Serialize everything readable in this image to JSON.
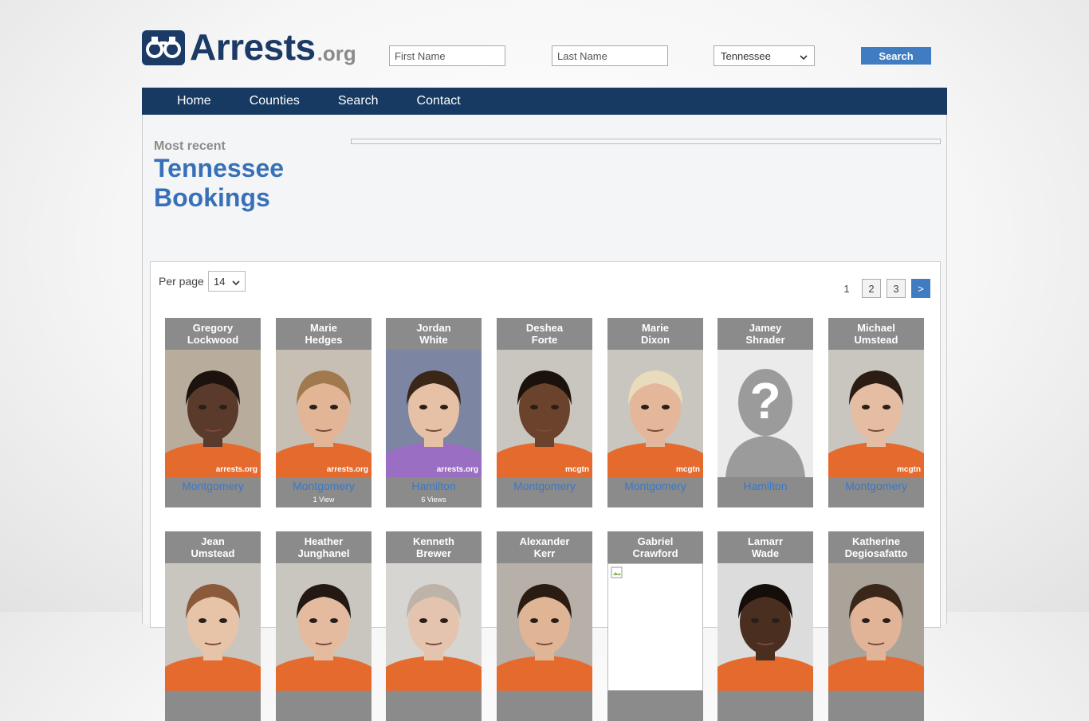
{
  "header": {
    "logo_word": "Arrests",
    "logo_suffix": ".org",
    "first_name_placeholder": "First Name",
    "last_name_placeholder": "Last Name",
    "state_selected": "Tennessee",
    "search_label": "Search"
  },
  "nav": [
    "Home",
    "Counties",
    "Search",
    "Contact"
  ],
  "section": {
    "eyebrow": "Most recent",
    "title_line1": "Tennessee",
    "title_line2": "Bookings"
  },
  "listing": {
    "per_page_label": "Per page",
    "per_page_value": "14",
    "pages": [
      "1",
      "2",
      "3"
    ],
    "next_label": ">"
  },
  "people": [
    {
      "first": "Gregory",
      "last": "Lockwood",
      "county": "Montgomery",
      "views": "",
      "skin": "#5a3a2a",
      "shirt": "#e56a2e",
      "bg": "#b8ad9c",
      "hair": "#1c130e",
      "watermark": "arrests.org"
    },
    {
      "first": "Marie",
      "last": "Hedges",
      "county": "Montgomery",
      "views": "1 View",
      "skin": "#e2b596",
      "shirt": "#e56a2e",
      "bg": "#c7bfb3",
      "hair": "#a07a4e",
      "watermark": "arrests.org"
    },
    {
      "first": "Jordan",
      "last": "White",
      "county": "Hamilton",
      "views": "6 Views",
      "skin": "#e7c1a6",
      "shirt": "#9a6ec2",
      "bg": "#7c86a2",
      "hair": "#3b2718",
      "watermark": "arrests.org"
    },
    {
      "first": "Deshea",
      "last": "Forte",
      "county": "Montgomery",
      "views": "",
      "skin": "#6b432c",
      "shirt": "#e56a2e",
      "bg": "#c9c6c0",
      "hair": "#1b120c",
      "watermark": "mcgtn"
    },
    {
      "first": "Marie",
      "last": "Dixon",
      "county": "Montgomery",
      "views": "",
      "skin": "#e4b79a",
      "shirt": "#e56a2e",
      "bg": "#c9c6c0",
      "hair": "#e9dcbc",
      "watermark": "mcgtn"
    },
    {
      "first": "Jamey",
      "last": "Shrader",
      "county": "Hamilton",
      "views": "",
      "skin": "",
      "shirt": "",
      "bg": "#ebebeb",
      "hair": "",
      "watermark": ""
    },
    {
      "first": "Michael",
      "last": "Umstead",
      "county": "Montgomery",
      "views": "",
      "skin": "#e5bda3",
      "shirt": "#e56a2e",
      "bg": "#c9c6c0",
      "hair": "#2c1d14",
      "watermark": "mcgtn"
    },
    {
      "first": "Jean",
      "last": "Umstead",
      "county": "",
      "views": "",
      "skin": "#e7c3a8",
      "shirt": "#e56a2e",
      "bg": "#c9c6c0",
      "hair": "#8a5a3a",
      "watermark": ""
    },
    {
      "first": "Heather",
      "last": "Junghanel",
      "county": "",
      "views": "",
      "skin": "#e4bb9f",
      "shirt": "#e56a2e",
      "bg": "#c9c6c0",
      "hair": "#231812",
      "watermark": ""
    },
    {
      "first": "Kenneth",
      "last": "Brewer",
      "county": "",
      "views": "",
      "skin": "#e4c4ae",
      "shirt": "#e56a2e",
      "bg": "#d7d5d2",
      "hair": "#bdb3a9",
      "watermark": ""
    },
    {
      "first": "Alexander",
      "last": "Kerr",
      "county": "",
      "views": "",
      "skin": "#e0b595",
      "shirt": "#e56a2e",
      "bg": "#b6b0a8",
      "hair": "#2a1c12",
      "watermark": ""
    },
    {
      "first": "Gabriel",
      "last": "Crawford",
      "county": "",
      "views": "",
      "skin": "",
      "shirt": "",
      "bg": "#ffffff",
      "hair": "",
      "watermark": ""
    },
    {
      "first": "Lamarr",
      "last": "Wade",
      "county": "",
      "views": "",
      "skin": "#4a2e20",
      "shirt": "#e56a2e",
      "bg": "#dcdcdc",
      "hair": "#140d09",
      "watermark": ""
    },
    {
      "first": "Katherine",
      "last": "Degiosafatto",
      "county": "",
      "views": "",
      "skin": "#e1b497",
      "shirt": "#e56a2e",
      "bg": "#a9a39a",
      "hair": "#3b261a",
      "watermark": ""
    }
  ]
}
